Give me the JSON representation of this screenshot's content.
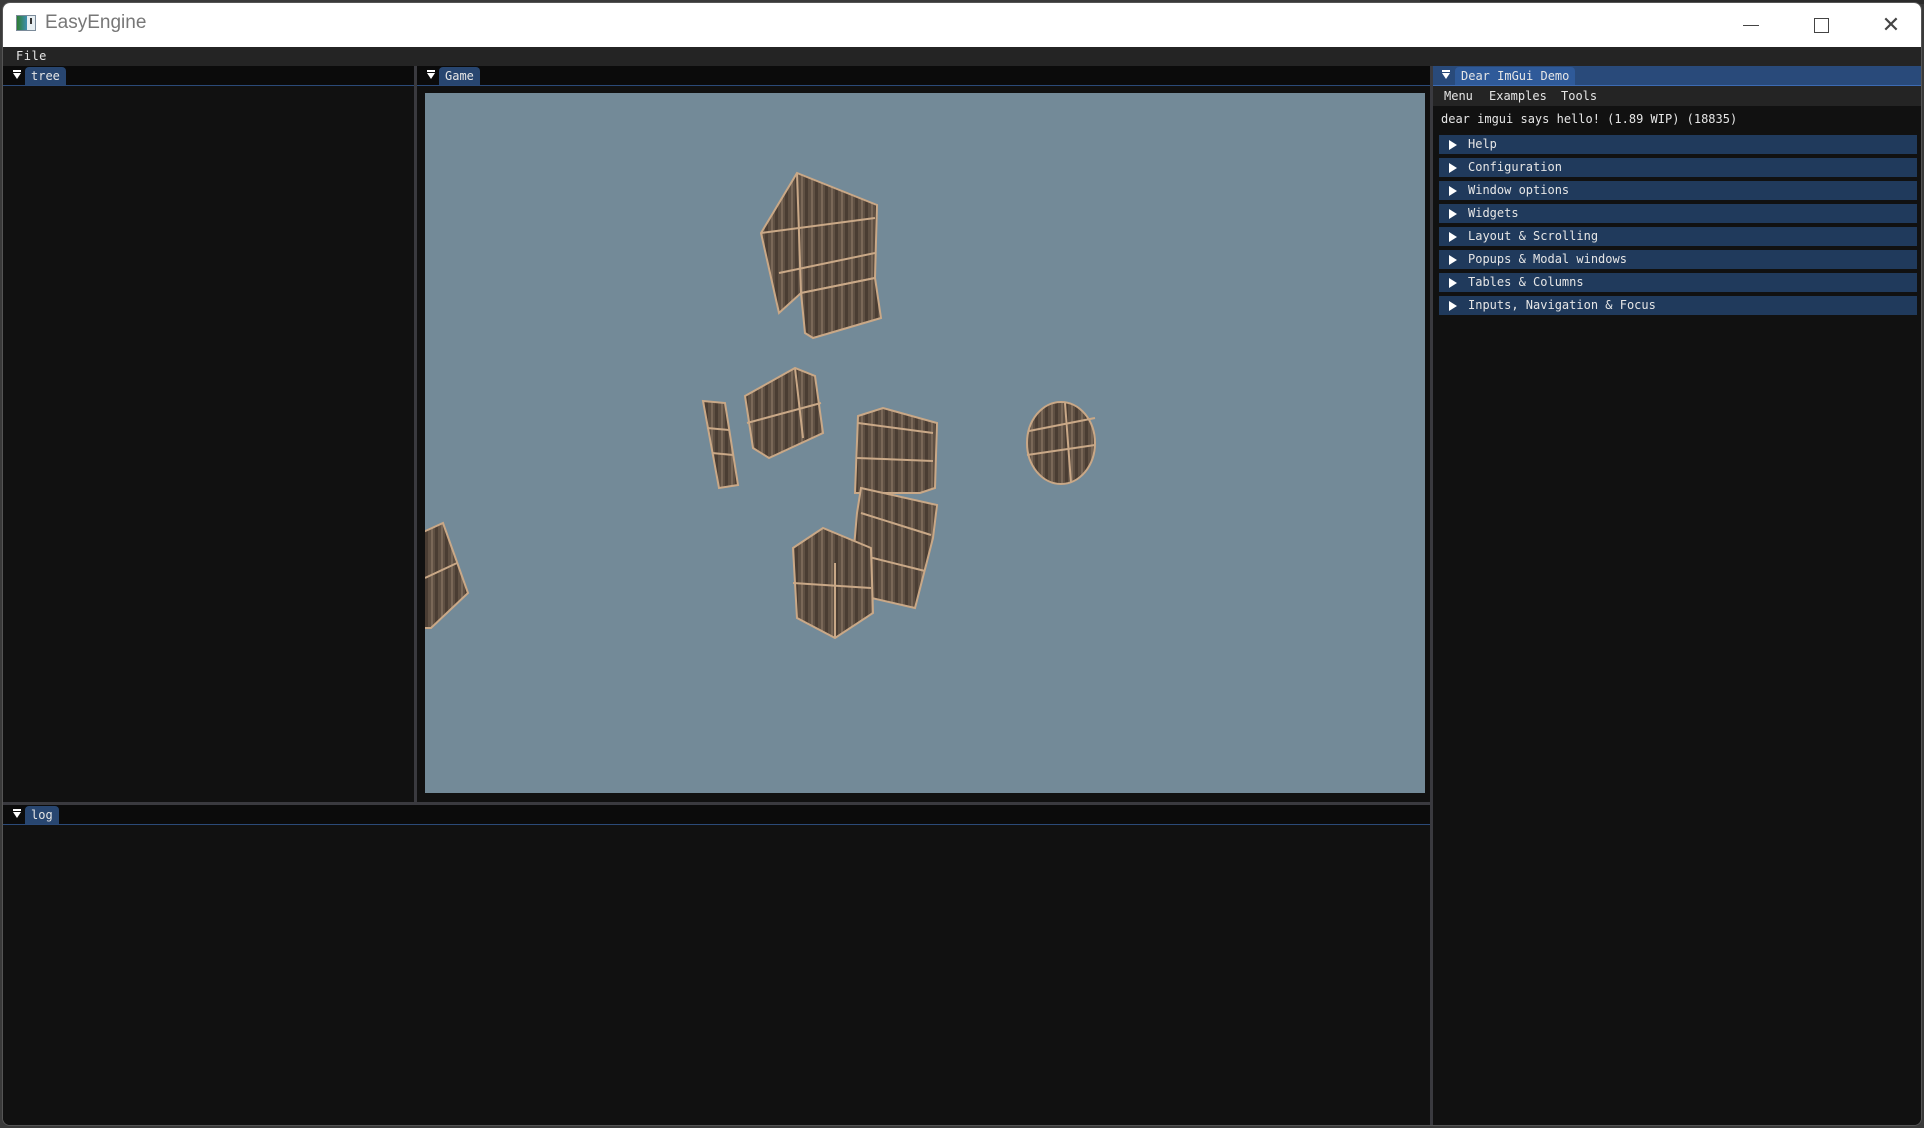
{
  "window": {
    "title": "EasyEngine",
    "controls": {
      "minimize": "minimize",
      "maximize": "maximize",
      "close": "close"
    }
  },
  "menubar": {
    "items": [
      "File"
    ]
  },
  "panels": {
    "tree": {
      "tab_label": "tree"
    },
    "game": {
      "tab_label": "Game",
      "viewport_background": "#738a98"
    },
    "log": {
      "tab_label": "log"
    },
    "demo": {
      "tab_label": "Dear ImGui Demo",
      "menu": [
        "Menu",
        "Examples",
        "Tools"
      ],
      "hello_text": "dear imgui says hello! (1.89 WIP) (18835)",
      "sections": [
        "Help",
        "Configuration",
        "Window options",
        "Widgets",
        "Layout & Scrolling",
        "Popups & Modal windows",
        "Tables & Columns",
        "Inputs, Navigation & Focus"
      ]
    }
  },
  "scene": {
    "objects": [
      "crate",
      "crate",
      "crate",
      "crate",
      "crate",
      "crate",
      "crate",
      "barrel",
      "crate-partial"
    ]
  },
  "colors": {
    "accent_tab": "#284670",
    "header_bg": "#203a5c",
    "panel_bg": "#111111",
    "crate_wood": "#6b5a4a"
  }
}
